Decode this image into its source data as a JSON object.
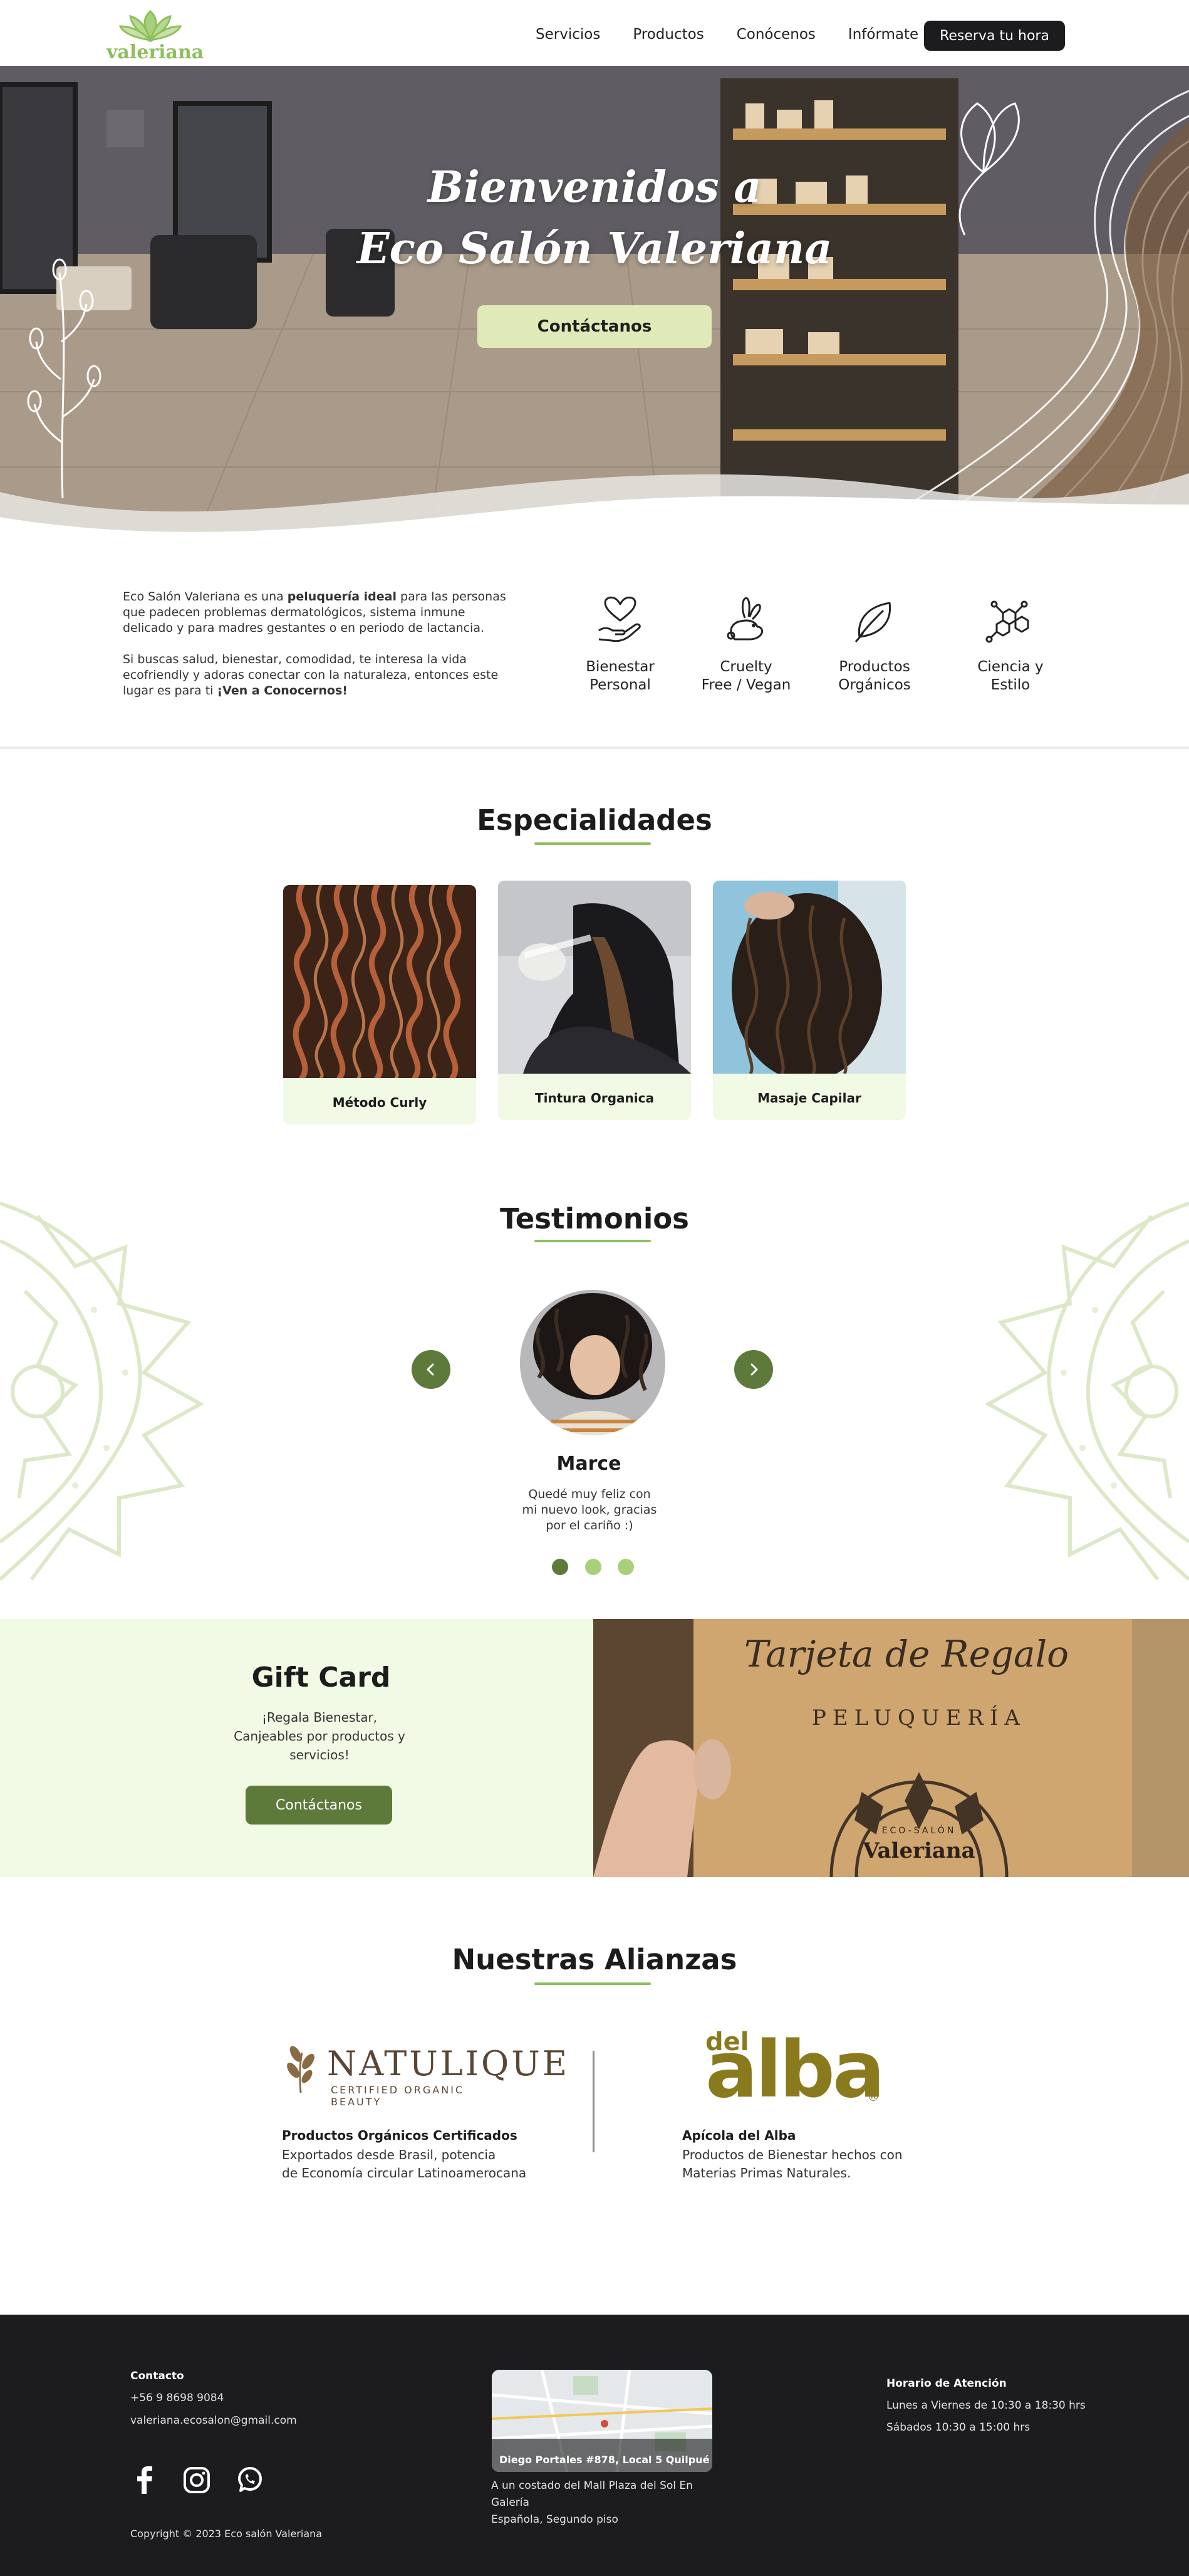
{
  "nav": {
    "logo_text": "valeriana",
    "links": [
      "Servicios",
      "Productos",
      "Conócenos",
      "Infórmate"
    ],
    "cta": "Reserva tu hora"
  },
  "hero": {
    "title_line1": "Bienvenidos a",
    "title_line2": "Eco Salón Valeriana",
    "button": "Contáctanos"
  },
  "intro": {
    "p1_a": "Eco Salón Valeriana es una ",
    "p1_b": "peluquería ideal",
    "p1_c": " para las personas que padecen problemas dermatológicos, sistema inmune delicado y para madres gestantes o en periodo de lactancia.",
    "p2_a": "Si buscas salud, bienestar, comodidad, te interesa la vida ecofriendly y adoras conectar con la naturaleza, entonces este lugar es para ti ",
    "p2_b": "¡Ven a Conocernos!",
    "features": [
      {
        "line1": "Bienestar",
        "line2": "Personal",
        "icon": "heart-hand-icon"
      },
      {
        "line1": "Cruelty",
        "line2": "Free / Vegan",
        "icon": "rabbit-icon"
      },
      {
        "line1": "Productos",
        "line2": "Orgánicos",
        "icon": "leaf-icon"
      },
      {
        "line1": "Ciencia y",
        "line2": "Estilo",
        "icon": "molecule-icon"
      }
    ]
  },
  "specialties": {
    "title": "Especialidades",
    "cards": [
      "Método Curly",
      "Tintura Organica",
      "Masaje Capilar"
    ]
  },
  "testimonials": {
    "title": "Testimonios",
    "name": "Marce",
    "quote": "Quedé muy feliz con mi nuevo look, gracias por el cariño :)"
  },
  "gift": {
    "title": "Gift Card",
    "text": "¡Regala Bienestar, Canjeables por  productos y servicios!",
    "button": "Contáctanos",
    "image_title": "Tarjeta de Regalo",
    "image_sub": "PELUQUERÍA",
    "image_brand_small": "ECO-SALÓN",
    "image_brand": "Valeriana"
  },
  "alliances": {
    "title": "Nuestras Alianzas",
    "natulique_logo": "NATULIQUE",
    "natulique_tag": "CERTIFIED ORGANIC BEAUTY",
    "natulique_name": "Productos Orgánicos Certificados",
    "natulique_desc1": "Exportados desde Brasil, potencia",
    "natulique_desc2": "de Economía circular Latinoamerocana",
    "alba_logo_small": "del",
    "alba_logo": "alba",
    "alba_reg": "®",
    "alba_name": "Apícola del Alba",
    "alba_desc1": "Productos de Bienestar hechos con",
    "alba_desc2": "Materias Primas Naturales."
  },
  "footer": {
    "contact_head": "Contacto",
    "phone": "+56 9 8698 9084",
    "email": "valeriana.ecosalon@gmail.com",
    "copyright": "Copyright © 2023 Eco salón Valeriana",
    "map_label": "Diego Portales #878, Local 5 Quilpué",
    "address1": "A un costado del Mall Plaza del Sol En Galería",
    "address2": "Española, Segundo piso",
    "hours_head": "Horario de Atención",
    "hours1": "Lunes a Viernes de 10:30 a 18:30 hrs",
    "hours2": "Sábados 10:30 a 15:00 hrs"
  },
  "colors": {
    "accent_green": "#5e7a3b",
    "light_green": "#f1fae4",
    "lime": "#dfeab8",
    "bar_green": "#8dbf5e",
    "dark": "#1c1c1e"
  }
}
